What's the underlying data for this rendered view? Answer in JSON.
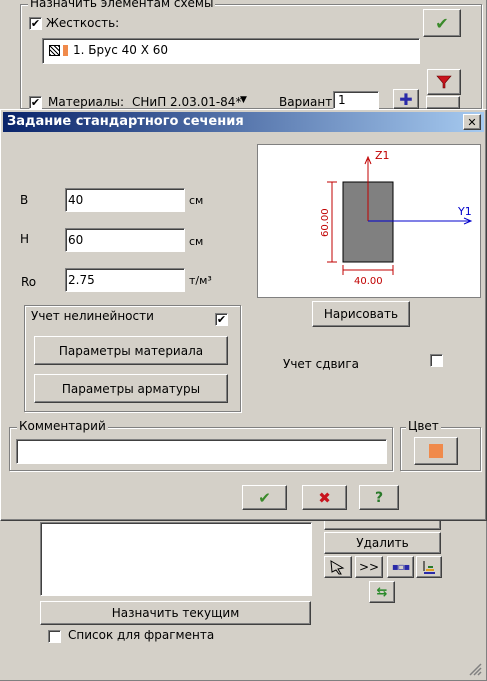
{
  "bg_window": {
    "group_title": "Назначить элементам схемы",
    "stiffness_label": "Жесткость:",
    "stiffness_checked": "✔",
    "stiffness_item": "1. Брус 40 X 60",
    "materials_label": "Материалы:",
    "materials_value": "СНиП 2.03.01-84*",
    "variant_label": "Вариант",
    "variant_value": "1",
    "delete_label": "Удалить",
    "next_label": ">>",
    "assign_current_label": "Назначить текущим",
    "fragment_list_label": "Список для фрагмента"
  },
  "dialog": {
    "title": "Задание стандартного сечения",
    "close_glyph": "✕",
    "b_label": "B",
    "b_value": "40",
    "b_unit": "см",
    "h_label": "H",
    "h_value": "60",
    "h_unit": "см",
    "ro_label": "Ro",
    "ro_value": "2.75",
    "ro_unit": "т/м³",
    "nonlinear_label": "Учет нелинейности",
    "nonlinear_checked": "✔",
    "material_params_label": "Параметры материала",
    "rebar_params_label": "Параметры арматуры",
    "draw_label": "Нарисовать",
    "shear_label": "Учет сдвига",
    "comment_label": "Комментарий",
    "comment_value": "",
    "color_label": "Цвет",
    "color_value": "#f08a4b",
    "ok_glyph": "✔",
    "cancel_glyph": "✖",
    "help_glyph": "?"
  },
  "preview": {
    "z_axis_label": "Z1",
    "y_axis_label": "Y1",
    "width_dim": "40.00",
    "height_dim": "60.00"
  },
  "colors": {
    "title_bar_start": "#0a246a",
    "title_bar_end": "#a6caf0",
    "ok_green": "#3a8a2a",
    "cancel_red": "#c8141e",
    "help_green": "#2a7a2a",
    "dimension_red": "#c00000",
    "axis_blue": "#0000cc"
  }
}
